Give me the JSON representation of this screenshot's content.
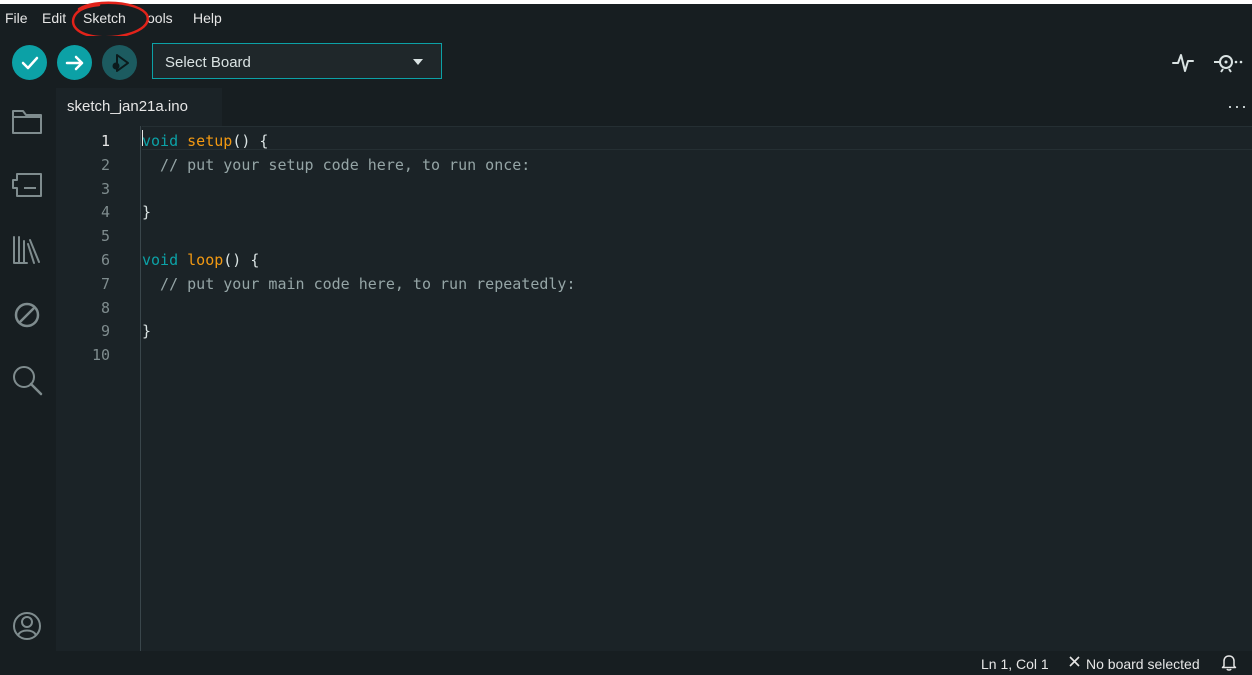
{
  "menu": {
    "items": [
      {
        "label": "File"
      },
      {
        "label": "Edit"
      },
      {
        "label": "Sketch"
      },
      {
        "label": "ools"
      },
      {
        "label": "Help"
      }
    ],
    "annotation_color": "#e2231a"
  },
  "toolbar": {
    "verify_icon": "checkmark-icon",
    "upload_icon": "arrow-right-icon",
    "debug_icon": "debugger-play-icon",
    "board_select": "Select Board",
    "plotter_icon": "serial-plotter-icon",
    "monitor_icon": "serial-monitor-icon"
  },
  "sidebar": {
    "icons": [
      "folder-icon",
      "boards-manager-icon",
      "library-manager-icon",
      "debug-prohibited-icon",
      "search-icon"
    ],
    "account_icon": "user-icon"
  },
  "tabs": {
    "active": "sketch_jan21a.ino",
    "more": "···"
  },
  "editor": {
    "line_numbers": [
      "1",
      "2",
      "3",
      "4",
      "5",
      "6",
      "7",
      "8",
      "9",
      "10"
    ],
    "code": {
      "l1_kw": "void",
      "l1_fn": "setup",
      "l1_rest": "() {",
      "l2": "  // put your setup code here, to run once:",
      "l4": "}",
      "l6_kw": "void",
      "l6_fn": "loop",
      "l6_rest": "() {",
      "l7": "  // put your main code here, to run repeatedly:",
      "l9": "}"
    }
  },
  "status": {
    "position": "Ln 1, Col 1",
    "board": "No board selected"
  },
  "colors": {
    "accent": "#0ca1a6",
    "keyword": "#0ca1a6",
    "function": "#f29912",
    "comment": "#95a5a6"
  }
}
